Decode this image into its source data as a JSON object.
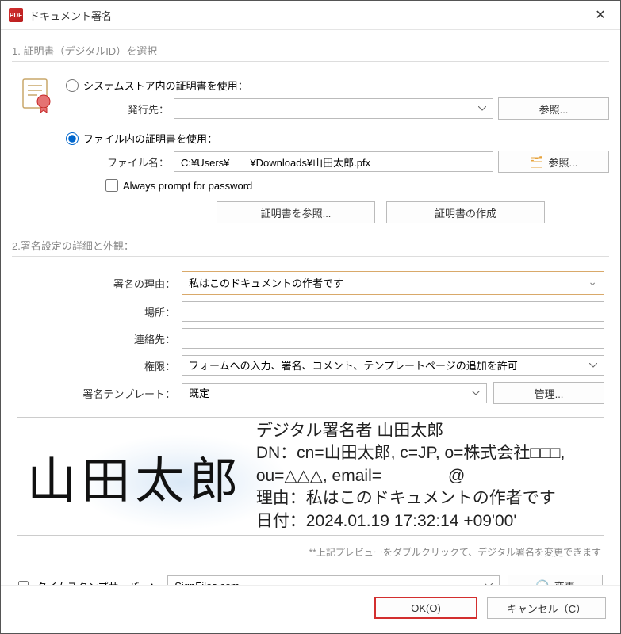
{
  "window": {
    "title": "ドキュメント署名"
  },
  "section1": {
    "header": "1. 証明書（デジタルID）を選択",
    "radio_system": "システムストア内の証明書を使用：",
    "issuer_label": "発行先：",
    "browse1": "参照...",
    "radio_file": "ファイル内の証明書を使用：",
    "filename_label": "ファイル名：",
    "filename_value": "C:¥Users¥　　¥Downloads¥山田太郎.pfx",
    "browse2": "参照...",
    "always_prompt": "Always prompt for password",
    "browse_cert": "証明書を参照...",
    "create_cert": "証明書の作成"
  },
  "section2": {
    "header": "2.署名設定の詳細と外観：",
    "reason_label": "署名の理由：",
    "reason_value": "私はこのドキュメントの作者です",
    "location_label": "場所：",
    "contact_label": "連絡先：",
    "perm_label": "権限：",
    "perm_value": "フォームへの入力、署名、コメント、テンプレートページの追加を許可",
    "template_label": "署名テンプレート：",
    "template_value": "既定",
    "manage": "管理..."
  },
  "preview": {
    "name": "山田太郎",
    "line1": "デジタル署名者 山田太郎",
    "line2": "DN：cn=山田太郎, c=JP, o=株式会社□□□, ou=△△△, email=　　　　@",
    "line3": "理由：私はこのドキュメントの作者です",
    "line4": "日付：2024.01.19 17:32:14 +09'00'",
    "hint": "**上記プレビューをダブルクリックて、デジタル署名を変更できます"
  },
  "timestamp": {
    "label": "タイムスタンプサーバー：",
    "value": "SignFiles.com",
    "change": "変更"
  },
  "footer": {
    "ok": "OK(O)",
    "cancel": "キャンセル（C）"
  }
}
